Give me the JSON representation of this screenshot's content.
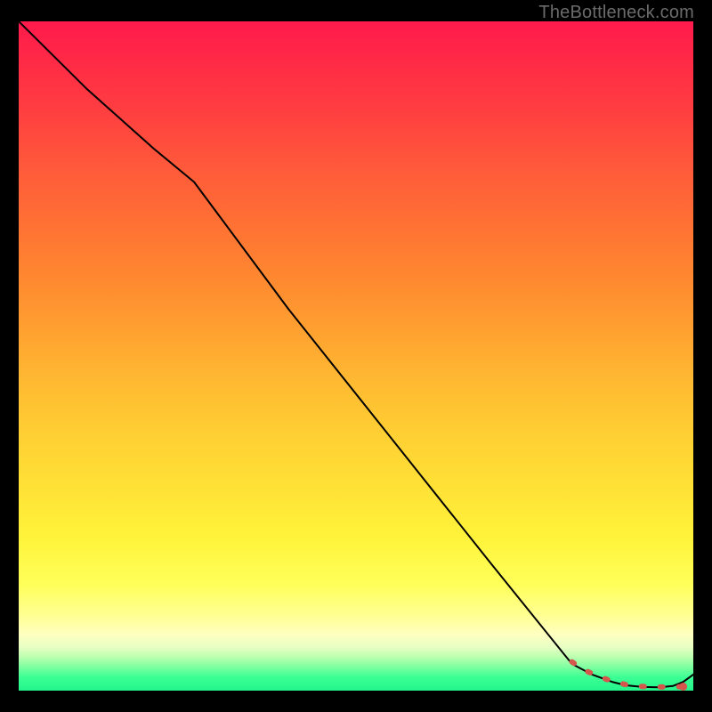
{
  "watermark": "TheBottleneck.com",
  "chart_data": {
    "type": "line",
    "title": "",
    "xlabel": "",
    "ylabel": "",
    "xlim": [
      0,
      100
    ],
    "ylim": [
      0,
      100
    ],
    "grid": false,
    "legend": false,
    "series": [
      {
        "name": "main-curve",
        "x": [
          0,
          10,
          20,
          26,
          40,
          55,
          70,
          82,
          85,
          88,
          90,
          92.5,
          95,
          97,
          98.5,
          100
        ],
        "y": [
          100,
          90,
          81,
          76,
          57,
          38,
          19,
          4,
          2.4,
          1.3,
          0.8,
          0.55,
          0.5,
          0.7,
          1.3,
          2.4
        ],
        "color": "#000000",
        "width": 2
      },
      {
        "name": "red-dotted-tail",
        "x": [
          82,
          84,
          86,
          88,
          90,
          92,
          94,
          96,
          98.5
        ],
        "y": [
          4.3,
          3.0,
          2.1,
          1.4,
          0.9,
          0.65,
          0.55,
          0.55,
          0.6
        ],
        "color": "#d4564d",
        "width": 6,
        "style": "dotted"
      }
    ],
    "background_gradient": {
      "direction": "top-to-bottom",
      "stops": [
        {
          "pos": 0.0,
          "color": "#ff1a4c"
        },
        {
          "pos": 0.3,
          "color": "#ff7034"
        },
        {
          "pos": 0.62,
          "color": "#ffd033"
        },
        {
          "pos": 0.84,
          "color": "#ffff59"
        },
        {
          "pos": 0.92,
          "color": "#ffffc0"
        },
        {
          "pos": 1.0,
          "color": "#22f58b"
        }
      ]
    }
  }
}
